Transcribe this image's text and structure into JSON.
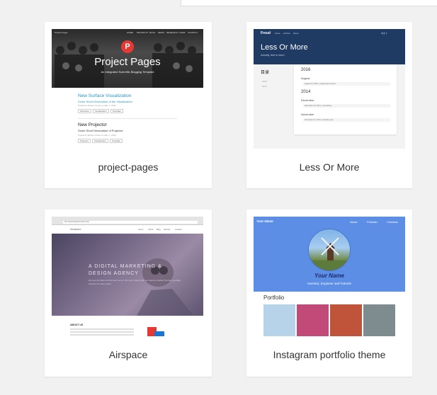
{
  "cards": [
    {
      "title": "project-pages",
      "thumb": {
        "nav": [
          "Project Pages",
          "HOME",
          "PROJECTS",
          "BLOG",
          "NEWS",
          "RESEARCH",
          "TEAM",
          "CONTACT"
        ],
        "logo_letter": "P",
        "hero_title": "Project Pages",
        "hero_subtitle": "An Integrated Scientific Blogging Template",
        "posts": [
          {
            "title": "New Surface Visualization",
            "subtitle": "Some Short Description of the Visualization",
            "meta": "Posted by Robert Crane on May 7, 2016",
            "tags": [
              "ParaView",
              "Visualization",
              "Template"
            ]
          },
          {
            "title": "New Projector",
            "subtitle": "Some Short Description of Projector",
            "meta": "Posted by Robert Crane on May 7, 2016",
            "tags": [
              "Projector",
              "Visualization",
              "Template"
            ]
          }
        ]
      }
    },
    {
      "title": "Less Or More",
      "thumb": {
        "brand": "Freud",
        "nav": [
          "home",
          "archive",
          "about"
        ],
        "nav_right": "中文 ▾",
        "title": "Less Or More",
        "tagline": "Actually, less is more!",
        "side_title": "目录",
        "side_items": [
          "2016",
          "2014"
        ],
        "archive": [
          {
            "year": "2016",
            "month": "August",
            "entries": [
              "August 29, 2016 » Jekyll theme Freud"
            ]
          },
          {
            "year": "2014",
            "month": "December",
            "entries": [
              "December 15, 2014 » Something"
            ]
          },
          {
            "year": "",
            "month": "November",
            "entries": [
              "November 27, 2014 » Another post"
            ]
          }
        ]
      }
    },
    {
      "title": "Airspace",
      "thumb": {
        "url": "file:///Users/airspace/index.html",
        "brand": "Airspace",
        "nav": [
          "Home",
          "About",
          "Blog",
          "Service",
          "Contact"
        ],
        "hero_line1": "A DIGITAL MARKETING &",
        "hero_line2": "DESIGN AGENCY",
        "hero_sub": "We love the Web and the work we do. We work closely with our clients to deliver the best possible solutions for their needs.",
        "about_title": "ABOUT US"
      }
    },
    {
      "title": "Instagram portfolio theme",
      "thumb": {
        "brand": "Your Name",
        "nav": [
          "About",
          "Portfolio",
          "Contacts"
        ],
        "name": "Your Name",
        "tagline": "Inventor, Engineer and Futurist",
        "portfolio_heading": "Portfolio",
        "tile_colors": [
          "#b7d3ea",
          "#c14a78",
          "#c0543a",
          "#7f8c8f"
        ]
      }
    }
  ]
}
